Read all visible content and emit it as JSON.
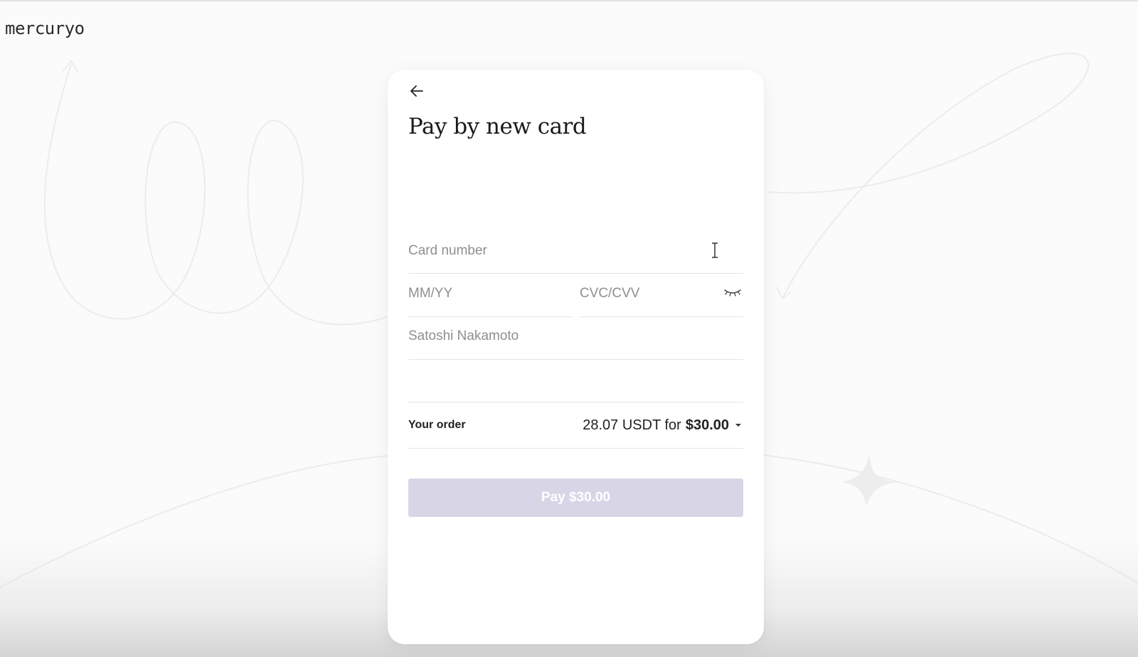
{
  "brand": {
    "logo_text": "mercuryo"
  },
  "payment_card": {
    "back_icon": "arrow-left-icon",
    "title": "Pay by new card",
    "fields": {
      "card_number": {
        "placeholder": "Card number",
        "value": ""
      },
      "expiry": {
        "placeholder": "MM/YY",
        "value": ""
      },
      "cvc": {
        "placeholder": "CVC/CVV",
        "value": ""
      },
      "cardholder": {
        "placeholder": "Satoshi Nakamoto",
        "value": ""
      }
    },
    "order": {
      "label": "Your order",
      "crypto_amount": "28.07 USDT for",
      "fiat_amount": "$30.00",
      "dropdown_icon": "caret-down-icon"
    },
    "pay_button": {
      "label": "Pay $30.00",
      "state": "disabled"
    }
  },
  "colors": {
    "background": "#fbfbfb",
    "card": "#ffffff",
    "pay_button_disabled": "#d8d5e7",
    "placeholder": "#8f8f8f"
  }
}
